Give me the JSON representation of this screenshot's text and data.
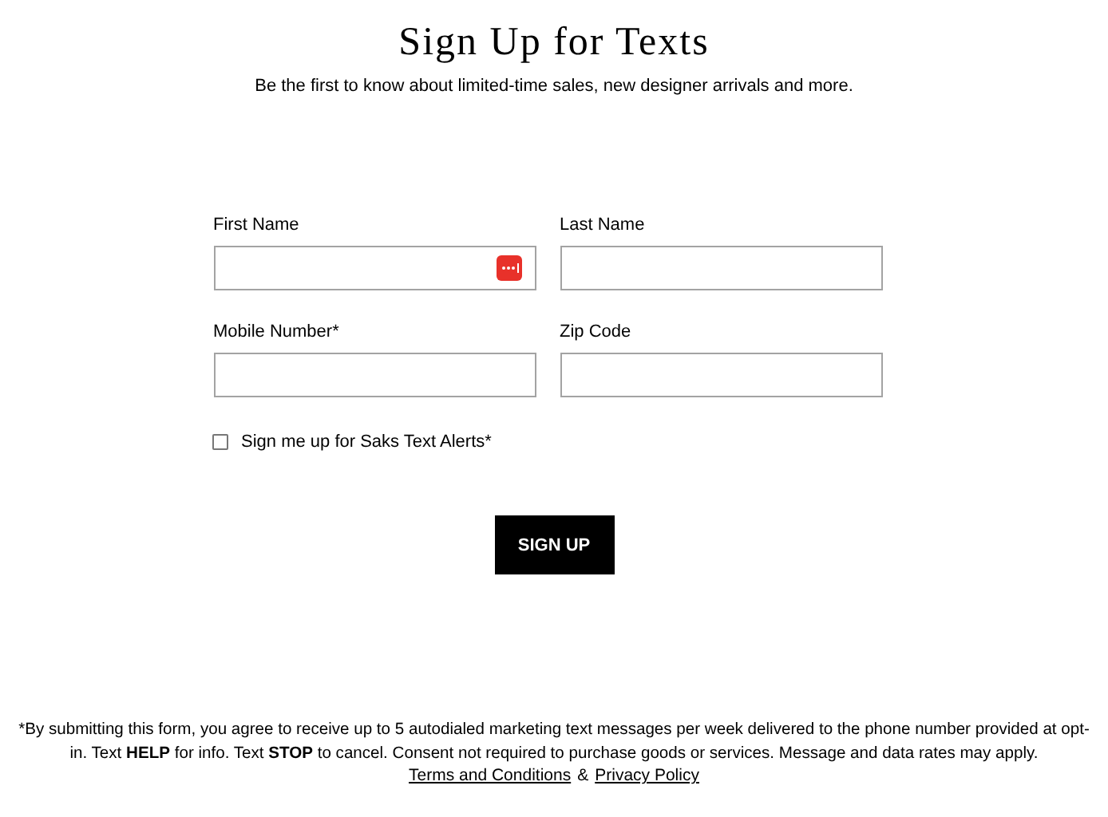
{
  "title": "Sign Up for Texts",
  "subtitle": "Be the first to know about limited-time sales, new designer arrivals and more.",
  "fields": [
    {
      "label": "First Name",
      "autofill_badge": true
    },
    {
      "label": "Last Name",
      "autofill_badge": false
    },
    {
      "label": "Mobile Number*",
      "autofill_badge": false
    },
    {
      "label": "Zip Code",
      "autofill_badge": false
    }
  ],
  "consent": {
    "label": "Sign me up for Saks Text Alerts*",
    "checked": false
  },
  "button": "SIGN UP",
  "disclaimer": "*By submitting this form, you agree to receive up to 5 autodialed marketing text messages per week delivered to the phone number provided at opt-in. Text **HELP** for info. Text **STOP** to cancel. Consent not required to purchase goods or services. Message and data rates may apply.",
  "links": [
    "Terms and Conditions",
    "Privacy Policy"
  ],
  "link_separator": "&"
}
